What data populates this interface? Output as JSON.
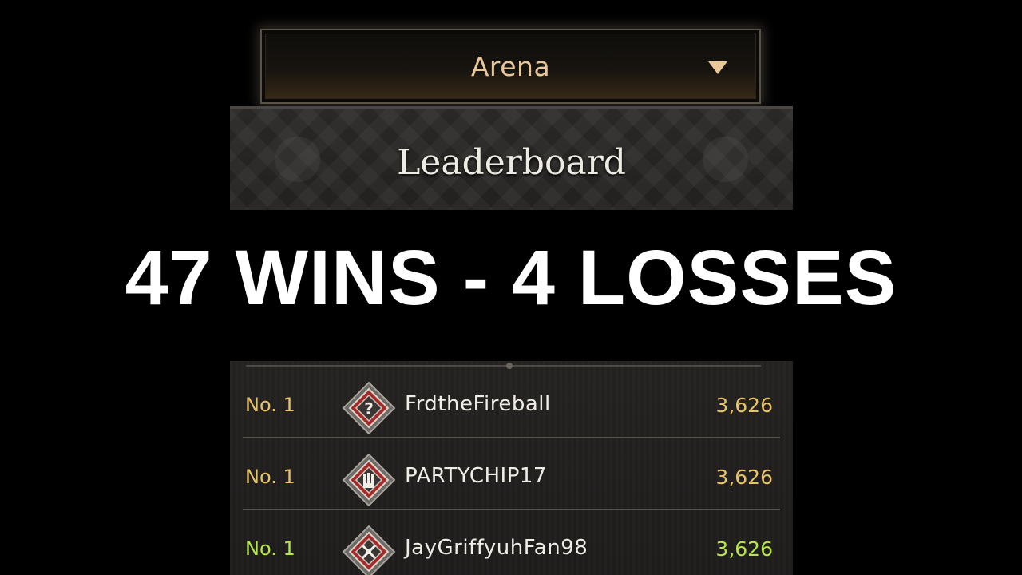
{
  "dropdown": {
    "selected": "Arena",
    "icon": "caret-down-icon"
  },
  "header": {
    "title": "Leaderboard"
  },
  "headline": {
    "text": "47 WINS - 4 LOSSES"
  },
  "leaderboard": {
    "rows": [
      {
        "rank": "No. 1",
        "name": "FrdtheFireball",
        "score": "3,626",
        "badge": "question-mark-emblem-icon",
        "color": "#e7c46a"
      },
      {
        "rank": "No. 1",
        "name": "PARTYCHIP17",
        "score": "3,626",
        "badge": "fist-emblem-icon",
        "color": "#e7c46a"
      },
      {
        "rank": "No. 1",
        "name": "JayGriffyuhFan98",
        "score": "3,626",
        "badge": "crossed-axes-emblem-icon",
        "color": "#b6e64a"
      }
    ]
  },
  "colors": {
    "gold": "#e7c46a",
    "green": "#b6e64a",
    "badge_red": "#a52a2a"
  }
}
